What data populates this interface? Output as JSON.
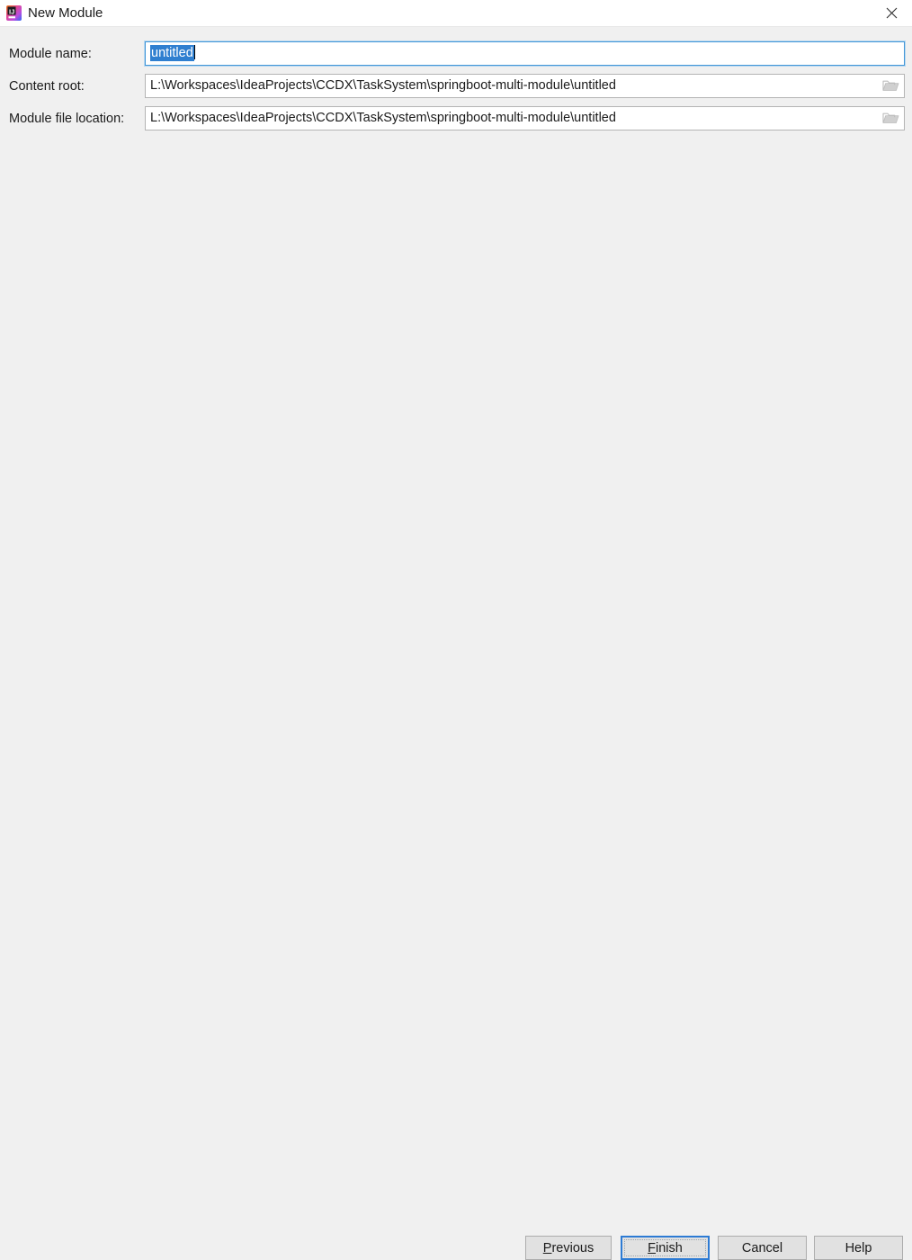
{
  "window": {
    "title": "New Module",
    "icon": "intellij-idea-icon",
    "close_label": "✕"
  },
  "form": {
    "rows": [
      {
        "label": "Module name:",
        "value": "untitled",
        "selected": true,
        "focused": true,
        "has_browse": false,
        "browse_icon": "folder-icon"
      },
      {
        "label": "Content root:",
        "value": "L:\\Workspaces\\IdeaProjects\\CCDX\\TaskSystem\\springboot-multi-module\\untitled",
        "selected": false,
        "focused": false,
        "has_browse": true,
        "browse_icon": "folder-icon"
      },
      {
        "label": "Module file location:",
        "value": "L:\\Workspaces\\IdeaProjects\\CCDX\\TaskSystem\\springboot-multi-module\\untitled",
        "selected": false,
        "focused": false,
        "has_browse": true,
        "browse_icon": "folder-icon"
      }
    ]
  },
  "buttons": {
    "previous": {
      "mnemonic": "P",
      "rest": "revious"
    },
    "finish": {
      "mnemonic": "F",
      "rest": "inish"
    },
    "cancel": {
      "label": "Cancel"
    },
    "help": {
      "label": "Help"
    }
  },
  "colors": {
    "accent_focus": "#2d7bd4",
    "selection": "#2f7fd0",
    "dialog_bg": "#f0f0f0",
    "titlebar_bg": "#ffffff",
    "field_bg": "#ffffff",
    "button_bg": "#e1e1e1"
  }
}
